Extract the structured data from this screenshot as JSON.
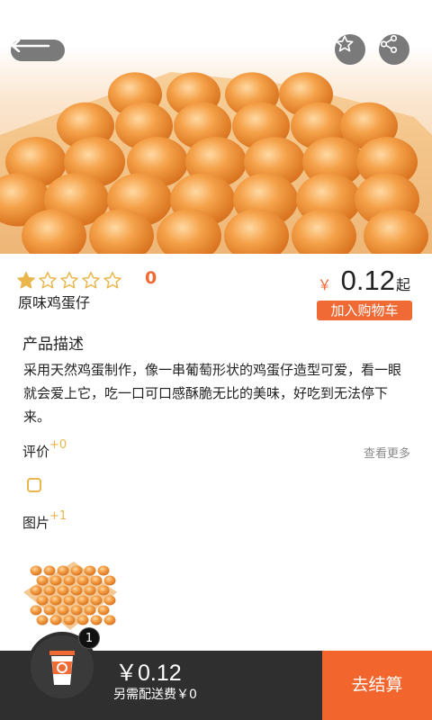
{
  "header": {
    "back_icon": "back-arrow-icon",
    "favorite_icon": "star-outline-icon",
    "share_icon": "share-icon"
  },
  "product": {
    "rating": 1,
    "rating_max": 5,
    "rating_count": "0",
    "name": "原味鸡蛋仔",
    "price_symbol": "￥",
    "price": "0.12",
    "price_suffix": "起",
    "add_to_cart_label": "加入购物车"
  },
  "description": {
    "title": "产品描述",
    "text": "采用天然鸡蛋制作，像一串葡萄形状的鸡蛋仔造型可爱，看一眼就会爱上它，吃一口可口感酥脆无比的美味，好吃到无法停下来。"
  },
  "reviews": {
    "label": "评价",
    "count": "+0",
    "see_more": "查看更多"
  },
  "pictures": {
    "label": "图片",
    "count": "+1"
  },
  "cart": {
    "badge": "1",
    "total": "￥0.12",
    "delivery": "另需配送费￥0",
    "checkout_label": "去结算",
    "icon": "coffee-cup-icon"
  },
  "colors": {
    "accent": "#f06a35",
    "checkout": "#f2662e",
    "bar": "#2f2f2f",
    "yellow": "#e8b64a"
  }
}
